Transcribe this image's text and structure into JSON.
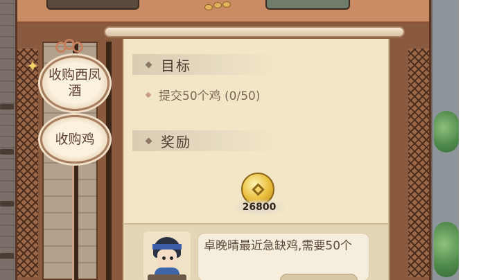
{
  "tabs": [
    {
      "label": "收购西凤酒",
      "selected": true
    },
    {
      "label": "收购鸡",
      "selected": false
    }
  ],
  "panel": {
    "goal_header": "目标",
    "goal_text": "提交50个鸡 (0/50)",
    "reward_header": "奖励",
    "reward": {
      "icon": "copper-coin-icon",
      "amount": "26800"
    }
  },
  "npc": {
    "dialog": "卓晚晴最近急缺鸡,需要50个"
  },
  "colors": {
    "panel_bg": "#f2e6c7",
    "header_text": "#4a3a2e",
    "goal_text": "#7d6555",
    "tab_border": "#a67d5e"
  }
}
